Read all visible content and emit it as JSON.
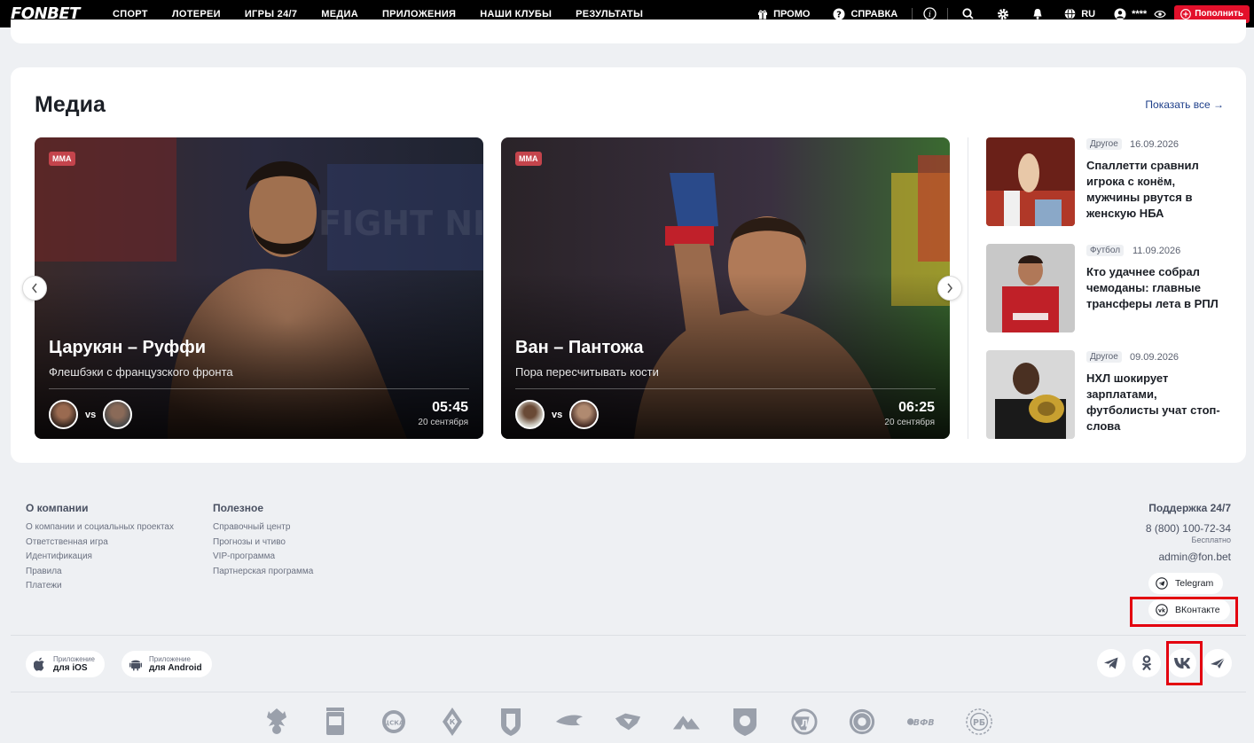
{
  "header": {
    "logo": "FONBET",
    "nav": [
      "СПОРТ",
      "ЛОТЕРЕИ",
      "ИГРЫ 24/7",
      "МЕДИА",
      "ПРИЛОЖЕНИЯ",
      "НАШИ КЛУБЫ",
      "РЕЗУЛЬТАТЫ"
    ],
    "promo": "ПРОМО",
    "help": "СПРАВКА",
    "language": "RU",
    "account_mask": "****",
    "deposit": "Пополнить"
  },
  "media": {
    "title": "Медиа",
    "show_all": "Показать все →",
    "vs_label": "vs",
    "slides": [
      {
        "tag": "MMA",
        "title": "Царукян – Руффи",
        "subtitle": "Флешбэки с французского фронта",
        "time": "05:45",
        "date": "20 сентября"
      },
      {
        "tag": "MMA",
        "title": "Ван – Пантожа",
        "subtitle": "Пора пересчитывать кости",
        "time": "06:25",
        "date": "20 сентября"
      }
    ],
    "news": [
      {
        "category": "Другое",
        "date": "16.09.2026",
        "title": "Спаллетти сравнил игрока с конём, мужчины рвутся в женскую НБА"
      },
      {
        "category": "Футбол",
        "date": "11.09.2026",
        "title": "Кто удачнее собрал чемоданы: главные трансферы лета в РПЛ"
      },
      {
        "category": "Другое",
        "date": "09.09.2026",
        "title": "НХЛ шокирует зарплатами, футболисты учат стоп-слова"
      }
    ]
  },
  "footer": {
    "company": {
      "heading": "О компании",
      "links": [
        "О компании и социальных проектах",
        "Ответственная игра",
        "Идентификация",
        "Правила",
        "Платежи"
      ]
    },
    "useful": {
      "heading": "Полезное",
      "links": [
        "Справочный центр",
        "Прогнозы и чтиво",
        "VIP-программа",
        "Партнерская программа"
      ]
    },
    "support": {
      "heading": "Поддержка 24/7",
      "phone": "8 (800) 100-72-34",
      "phone_note": "Бесплатно",
      "email": "admin@fon.bet",
      "telegram": "Telegram",
      "vkontakte": "ВКонтакте"
    },
    "apps": [
      {
        "small": "Приложение",
        "label": "для iOS"
      },
      {
        "small": "Приложение",
        "label": "для Android"
      }
    ],
    "club_logos_text": {
      "vfv": "ВФВ",
      "rb": "РБ"
    }
  },
  "colors": {
    "accent_red": "#e3102b",
    "link_blue": "#1e3f8a",
    "highlight": "#e3000f",
    "tag_bg": "#c4444c"
  }
}
